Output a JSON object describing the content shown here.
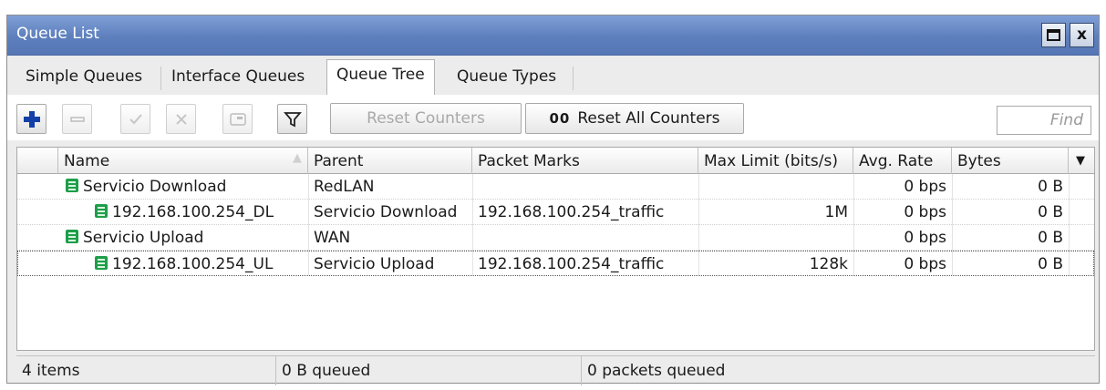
{
  "window": {
    "title": "Queue List",
    "controls": [
      "restore-icon",
      "close-icon"
    ],
    "close_glyph": "x"
  },
  "tabs": [
    {
      "label": "Simple Queues",
      "active": false
    },
    {
      "label": "Interface Queues",
      "active": false
    },
    {
      "label": "Queue Tree",
      "active": true
    },
    {
      "label": "Queue Types",
      "active": false
    }
  ],
  "toolbar": {
    "icons": [
      "add-icon",
      "remove-icon",
      "enable-icon",
      "disable-icon",
      "comment-icon",
      "filter-icon"
    ],
    "reset_counters_label": "Reset Counters",
    "reset_all_prefix": "00",
    "reset_all_label": "Reset All Counters",
    "find_placeholder": "Find"
  },
  "table": {
    "columns": [
      "Name",
      "Parent",
      "Packet Marks",
      "Max Limit (bits/s)",
      "Avg. Rate",
      "Bytes"
    ],
    "rows": [
      {
        "name": "Servicio Download",
        "parent": "RedLAN",
        "packet_marks": "",
        "max_limit": "",
        "avg_rate": "0 bps",
        "bytes": "0 B",
        "level": 0
      },
      {
        "name": "192.168.100.254_DL",
        "parent": "Servicio Download",
        "packet_marks": "192.168.100.254_traffic",
        "max_limit": "1M",
        "avg_rate": "0 bps",
        "bytes": "0 B",
        "level": 1
      },
      {
        "name": "Servicio Upload",
        "parent": "WAN",
        "packet_marks": "",
        "max_limit": "",
        "avg_rate": "0 bps",
        "bytes": "0 B",
        "level": 0
      },
      {
        "name": "192.168.100.254_UL",
        "parent": "Servicio Upload",
        "packet_marks": "192.168.100.254_traffic",
        "max_limit": "128k",
        "avg_rate": "0 bps",
        "bytes": "0 B",
        "level": 1
      }
    ]
  },
  "status": {
    "items": "4 items",
    "queued_bytes": "0 B queued",
    "queued_packets": "0 packets queued"
  },
  "colors": {
    "titlebar": "#5d7fbc",
    "queue_icon": "#1e9e4a",
    "add_icon": "#1240a8"
  }
}
